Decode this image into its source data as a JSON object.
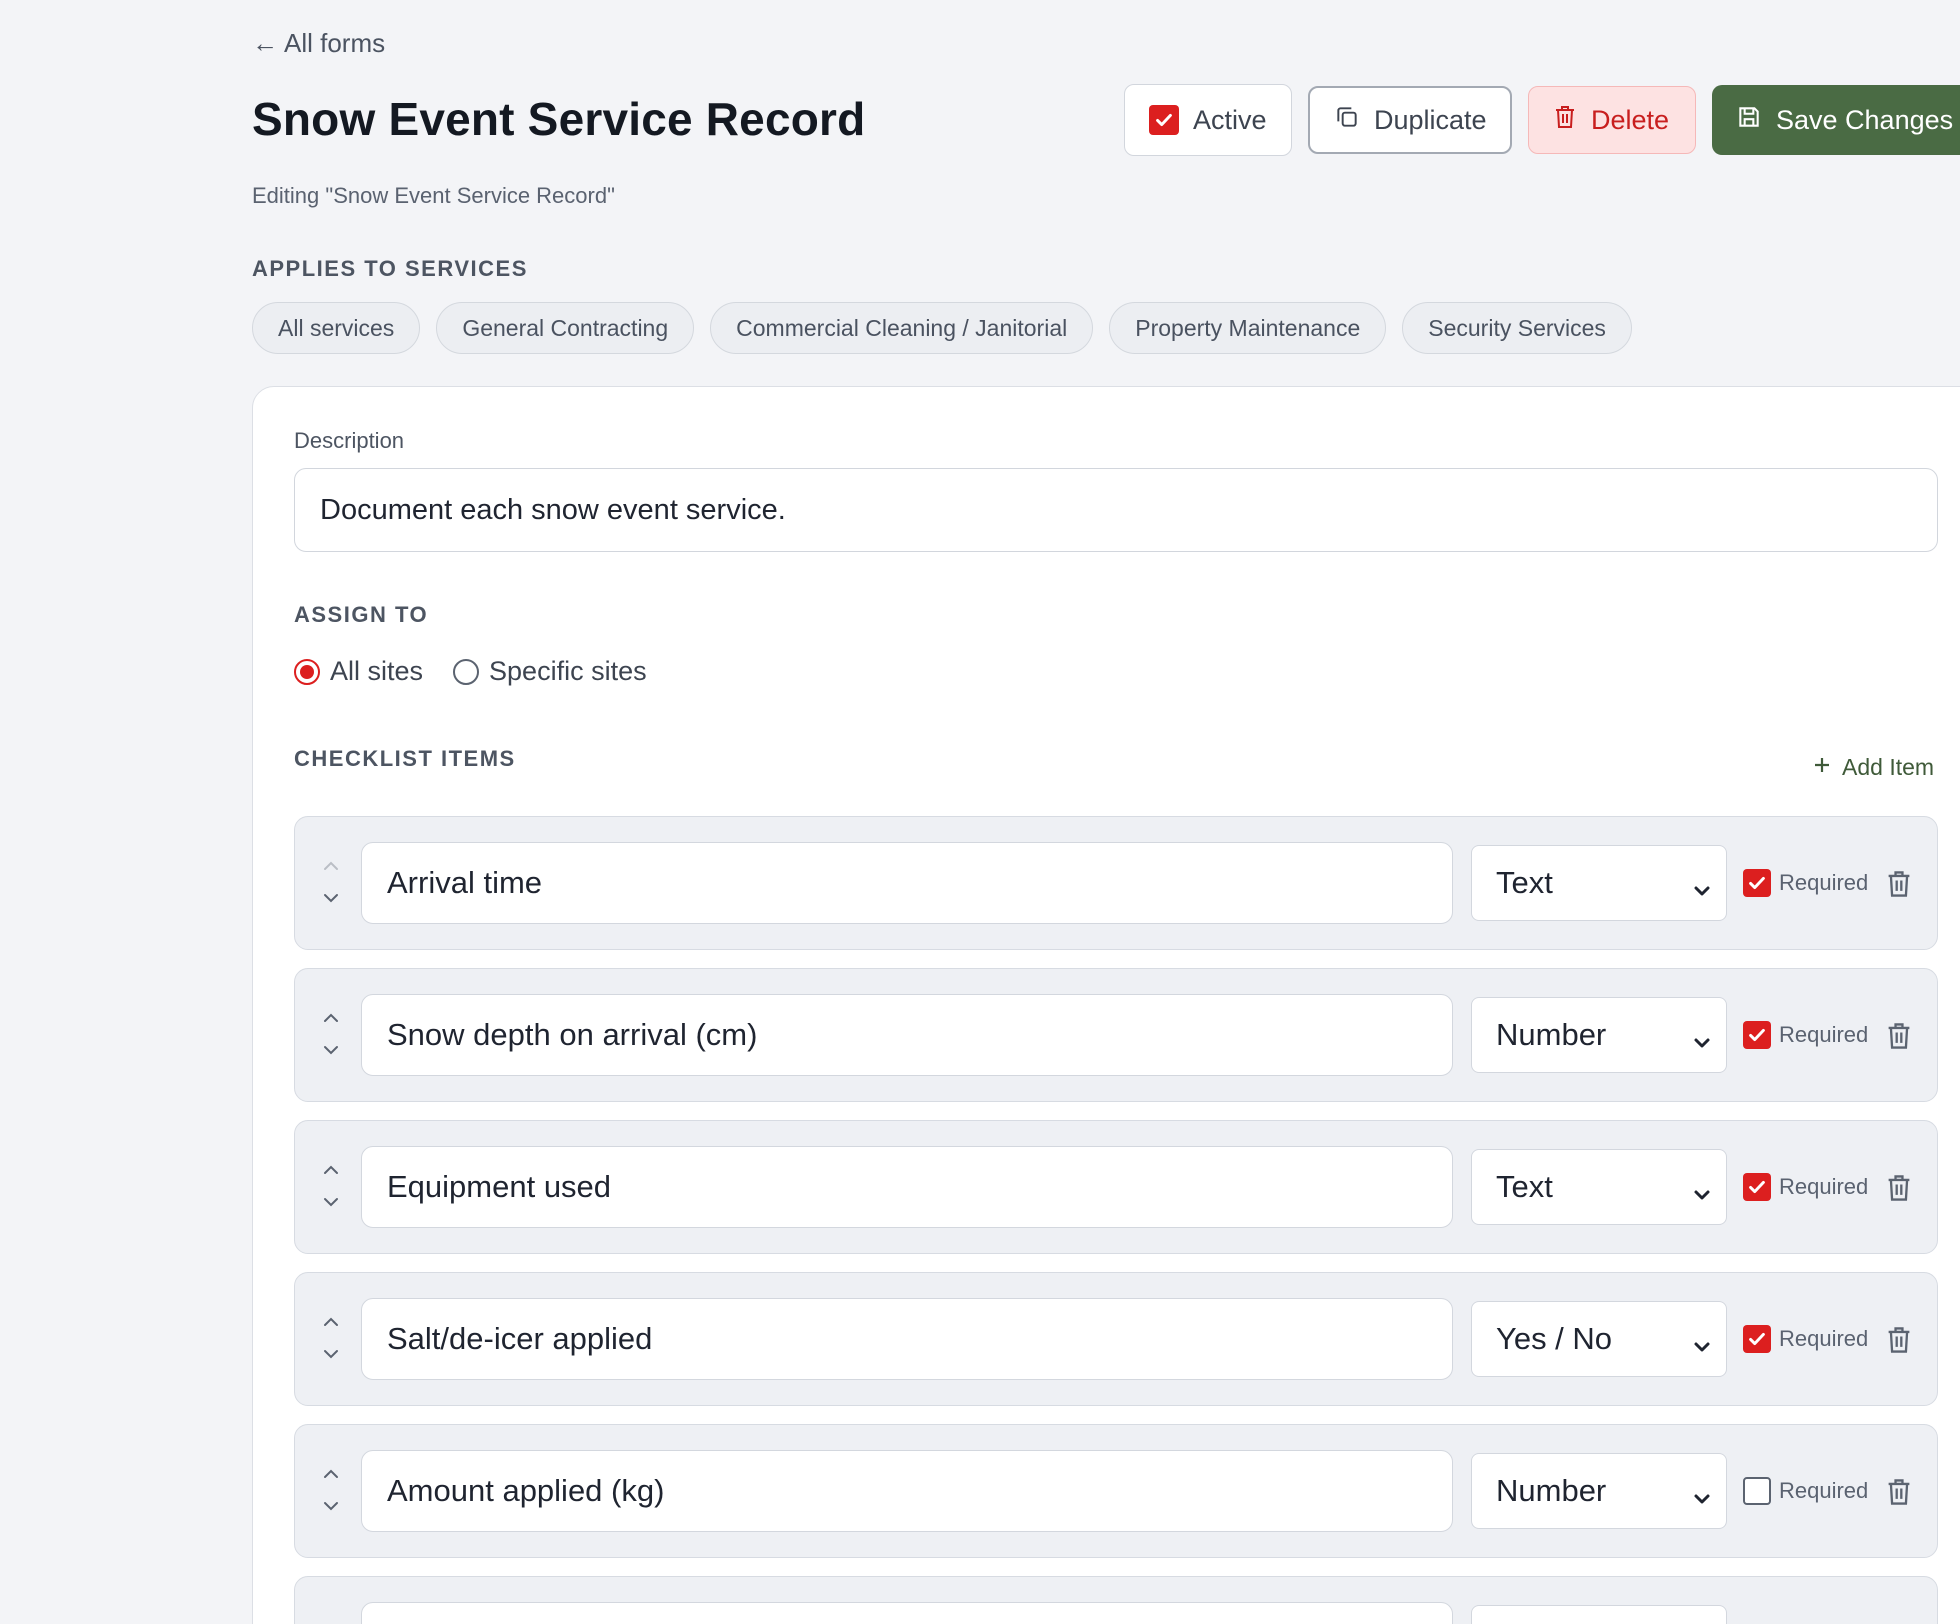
{
  "nav": {
    "back_label": "All forms"
  },
  "header": {
    "title": "Snow Event Service Record",
    "subtitle": "Editing \"Snow Event Service Record\"",
    "active_label": "Active",
    "duplicate_label": "Duplicate",
    "delete_label": "Delete",
    "save_label": "Save Changes"
  },
  "services": {
    "label": "APPLIES TO SERVICES",
    "chips": [
      "All services",
      "General Contracting",
      "Commercial Cleaning / Janitorial",
      "Property Maintenance",
      "Security Services"
    ]
  },
  "form": {
    "description_label": "Description",
    "description_value": "Document each snow event service.",
    "assign_label": "ASSIGN TO",
    "assign_options": [
      "All sites",
      "Specific sites"
    ],
    "assign_selected": "All sites",
    "checklist_label": "CHECKLIST ITEMS",
    "add_item_label": "Add Item",
    "required_label": "Required",
    "items": [
      {
        "text": "Arrival time",
        "type": "Text",
        "required": true
      },
      {
        "text": "Snow depth on arrival (cm)",
        "type": "Number",
        "required": true
      },
      {
        "text": "Equipment used",
        "type": "Text",
        "required": true
      },
      {
        "text": "Salt/de-icer applied",
        "type": "Yes / No",
        "required": true
      },
      {
        "text": "Amount applied (kg)",
        "type": "Number",
        "required": false
      }
    ]
  },
  "colors": {
    "accent_red": "#dc1f1f",
    "save_green": "#4a6b44",
    "delete_bg": "#fde2e2",
    "page_bg": "#f3f4f7"
  },
  "icons": [
    "arrow-left-icon",
    "checkbox-checked-icon",
    "copy-icon",
    "trash-icon",
    "save-icon",
    "plus-icon",
    "chevron-up-icon",
    "chevron-down-icon"
  ]
}
